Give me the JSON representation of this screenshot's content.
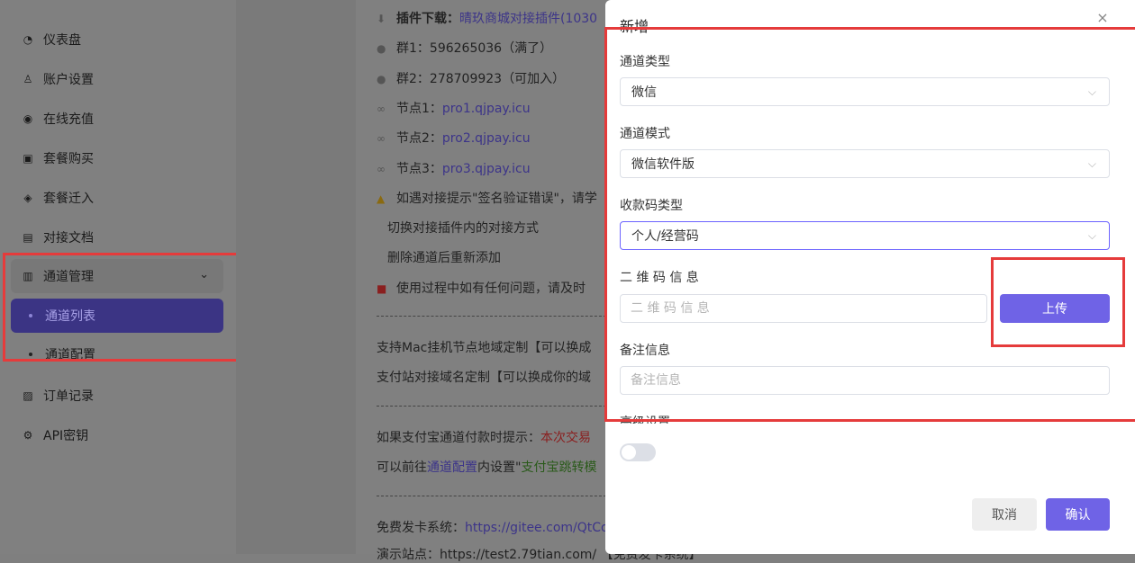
{
  "sidebar": {
    "items": [
      {
        "label": "仪表盘",
        "icon": "dashboard-icon",
        "glyph": "◔"
      },
      {
        "label": "账户设置",
        "icon": "user-settings-icon",
        "glyph": "♙"
      },
      {
        "label": "在线充值",
        "icon": "recharge-icon",
        "glyph": "◉"
      },
      {
        "label": "套餐购买",
        "icon": "package-buy-icon",
        "glyph": "▣"
      },
      {
        "label": "套餐迁入",
        "icon": "package-migrate-icon",
        "glyph": "◈"
      },
      {
        "label": "对接文档",
        "icon": "document-icon",
        "glyph": "▤"
      }
    ],
    "group": {
      "label": "通道管理",
      "icon": "channel-icon",
      "glyph": "▥",
      "chevron": "⌄"
    },
    "sub_items": [
      {
        "label": "通道列表"
      },
      {
        "label": "通道配置"
      }
    ],
    "after_items": [
      {
        "label": "订单记录",
        "icon": "order-icon",
        "glyph": "▨"
      },
      {
        "label": "API密钥",
        "icon": "key-icon",
        "glyph": "⚙"
      }
    ]
  },
  "content": {
    "plugin_label": "插件下载：",
    "plugin_link": "晴玖商城对接插件(1030",
    "group1": "群1：596265036（满了）",
    "group2": "群2：278709923（可加入）",
    "node1_label": "节点1：",
    "node1": "pro1.qjpay.icu",
    "node2_label": "节点2：",
    "node2": "pro2.qjpay.icu",
    "node3_label": "节点3：",
    "node3": "pro3.qjpay.icu",
    "warn": "如遇对接提示\"签名验证错误\"，请学",
    "tip1": "切换对接插件内的对接方式",
    "tip2": "删除通道后重新添加",
    "tip3": "使用过程中如有任何问题，请及时",
    "mac": "支持Mac挂机节点地域定制【可以换成",
    "domain": "支付站对接域名定制【可以换成你的域",
    "alipay_prefix": "如果支付宝通道付款时提示：",
    "alipay_red": "本次交易",
    "goto_prefix": "可以前往",
    "goto_link": "通道配置",
    "goto_mid": "内设置\"",
    "goto_green": "支付宝跳转模",
    "free_label": "免费发卡系统：",
    "free_link": "https://gitee.com/QtCo",
    "demo": "演示站点：https://test2.79tian.com/  【免费发卡系统】"
  },
  "modal": {
    "title": "新增",
    "close": "×",
    "channel_type_label": "通道类型",
    "channel_type_value": "微信",
    "channel_mode_label": "通道模式",
    "channel_mode_value": "微信软件版",
    "qr_type_label": "收款码类型",
    "qr_type_value": "个人/经营码",
    "qr_info_label": "二 维 码 信 息",
    "qr_info_placeholder": "二 维 码 信 息",
    "upload": "上传",
    "remark_label": "备注信息",
    "remark_placeholder": "备注信息",
    "advanced_label": "高级设置",
    "cancel": "取消",
    "confirm": "确认"
  },
  "colors": {
    "accent": "#6f63e6",
    "highlight_box": "#e53b3b"
  }
}
